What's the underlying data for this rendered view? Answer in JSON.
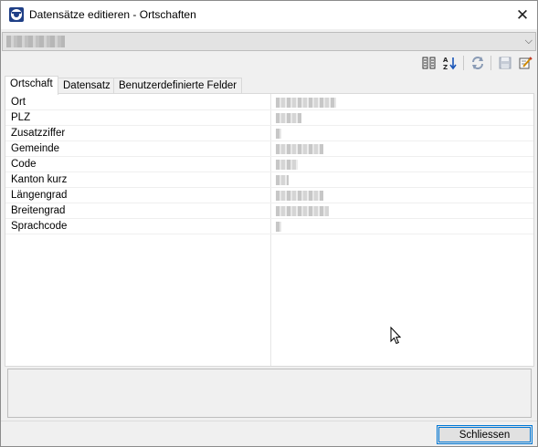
{
  "window": {
    "title": "Datensätze editieren - Ortschaften",
    "close_glyph": "✕"
  },
  "record_selector": {
    "selected_value": "▒▒ ▒▒▒▒▒▒▒▒",
    "dropdown_glyph": "⌵"
  },
  "toolbar": {
    "items": [
      {
        "name": "columns-icon"
      },
      {
        "name": "sort-az-icon"
      },
      {
        "name": "refresh-icon"
      },
      {
        "name": "save-icon"
      },
      {
        "name": "edit-note-icon"
      }
    ]
  },
  "tabs": [
    {
      "label": "Ortschaft",
      "active": true
    },
    {
      "label": "Datensatz",
      "active": false
    },
    {
      "label": "Benutzerdefinierte Felder",
      "active": false
    }
  ],
  "fields": [
    {
      "label": "Ort",
      "value": "▒▒ ▒▒▒▒▒▒▒▒▒"
    },
    {
      "label": "PLZ",
      "value": "▒▒▒▒"
    },
    {
      "label": "Zusatzziffer",
      "value": "▒"
    },
    {
      "label": "Gemeinde",
      "value": "▒▒▒▒▒▒▒▒"
    },
    {
      "label": "Code",
      "value": "▒▒▒"
    },
    {
      "label": "Kanton kurz",
      "value": "▒▒"
    },
    {
      "label": "Längengrad",
      "value": "▒▒▒▒▒▒▒▒▒▒"
    },
    {
      "label": "Breitengrad",
      "value": "▒▒ ▒▒▒▒▒▒▒▒"
    },
    {
      "label": "Sprachcode",
      "value": "▒"
    }
  ],
  "description": "",
  "footer": {
    "close_button_label": "Schliessen"
  }
}
